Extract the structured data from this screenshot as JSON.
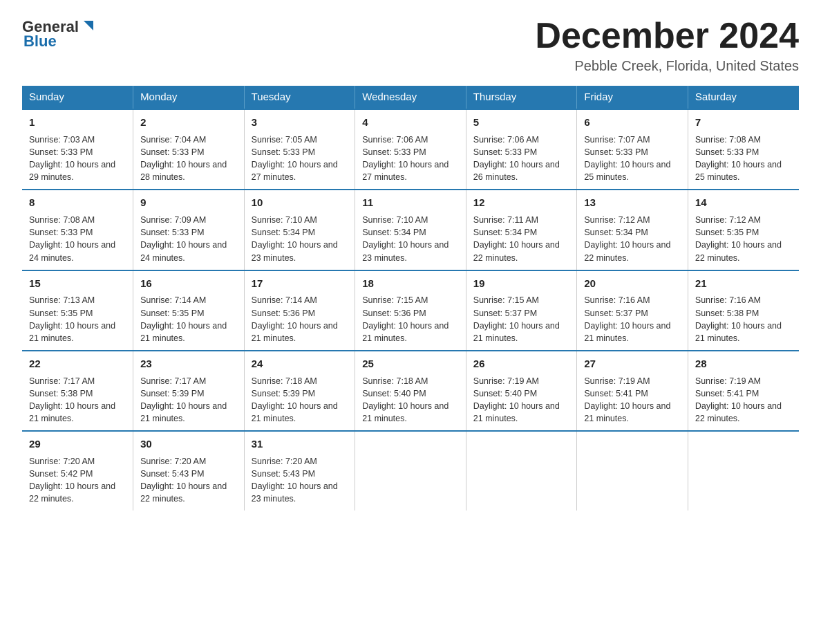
{
  "logo": {
    "general": "General",
    "blue": "Blue"
  },
  "title": "December 2024",
  "subtitle": "Pebble Creek, Florida, United States",
  "days_of_week": [
    "Sunday",
    "Monday",
    "Tuesday",
    "Wednesday",
    "Thursday",
    "Friday",
    "Saturday"
  ],
  "weeks": [
    [
      {
        "day": "1",
        "sunrise": "7:03 AM",
        "sunset": "5:33 PM",
        "daylight": "10 hours and 29 minutes."
      },
      {
        "day": "2",
        "sunrise": "7:04 AM",
        "sunset": "5:33 PM",
        "daylight": "10 hours and 28 minutes."
      },
      {
        "day": "3",
        "sunrise": "7:05 AM",
        "sunset": "5:33 PM",
        "daylight": "10 hours and 27 minutes."
      },
      {
        "day": "4",
        "sunrise": "7:06 AM",
        "sunset": "5:33 PM",
        "daylight": "10 hours and 27 minutes."
      },
      {
        "day": "5",
        "sunrise": "7:06 AM",
        "sunset": "5:33 PM",
        "daylight": "10 hours and 26 minutes."
      },
      {
        "day": "6",
        "sunrise": "7:07 AM",
        "sunset": "5:33 PM",
        "daylight": "10 hours and 25 minutes."
      },
      {
        "day": "7",
        "sunrise": "7:08 AM",
        "sunset": "5:33 PM",
        "daylight": "10 hours and 25 minutes."
      }
    ],
    [
      {
        "day": "8",
        "sunrise": "7:08 AM",
        "sunset": "5:33 PM",
        "daylight": "10 hours and 24 minutes."
      },
      {
        "day": "9",
        "sunrise": "7:09 AM",
        "sunset": "5:33 PM",
        "daylight": "10 hours and 24 minutes."
      },
      {
        "day": "10",
        "sunrise": "7:10 AM",
        "sunset": "5:34 PM",
        "daylight": "10 hours and 23 minutes."
      },
      {
        "day": "11",
        "sunrise": "7:10 AM",
        "sunset": "5:34 PM",
        "daylight": "10 hours and 23 minutes."
      },
      {
        "day": "12",
        "sunrise": "7:11 AM",
        "sunset": "5:34 PM",
        "daylight": "10 hours and 22 minutes."
      },
      {
        "day": "13",
        "sunrise": "7:12 AM",
        "sunset": "5:34 PM",
        "daylight": "10 hours and 22 minutes."
      },
      {
        "day": "14",
        "sunrise": "7:12 AM",
        "sunset": "5:35 PM",
        "daylight": "10 hours and 22 minutes."
      }
    ],
    [
      {
        "day": "15",
        "sunrise": "7:13 AM",
        "sunset": "5:35 PM",
        "daylight": "10 hours and 21 minutes."
      },
      {
        "day": "16",
        "sunrise": "7:14 AM",
        "sunset": "5:35 PM",
        "daylight": "10 hours and 21 minutes."
      },
      {
        "day": "17",
        "sunrise": "7:14 AM",
        "sunset": "5:36 PM",
        "daylight": "10 hours and 21 minutes."
      },
      {
        "day": "18",
        "sunrise": "7:15 AM",
        "sunset": "5:36 PM",
        "daylight": "10 hours and 21 minutes."
      },
      {
        "day": "19",
        "sunrise": "7:15 AM",
        "sunset": "5:37 PM",
        "daylight": "10 hours and 21 minutes."
      },
      {
        "day": "20",
        "sunrise": "7:16 AM",
        "sunset": "5:37 PM",
        "daylight": "10 hours and 21 minutes."
      },
      {
        "day": "21",
        "sunrise": "7:16 AM",
        "sunset": "5:38 PM",
        "daylight": "10 hours and 21 minutes."
      }
    ],
    [
      {
        "day": "22",
        "sunrise": "7:17 AM",
        "sunset": "5:38 PM",
        "daylight": "10 hours and 21 minutes."
      },
      {
        "day": "23",
        "sunrise": "7:17 AM",
        "sunset": "5:39 PM",
        "daylight": "10 hours and 21 minutes."
      },
      {
        "day": "24",
        "sunrise": "7:18 AM",
        "sunset": "5:39 PM",
        "daylight": "10 hours and 21 minutes."
      },
      {
        "day": "25",
        "sunrise": "7:18 AM",
        "sunset": "5:40 PM",
        "daylight": "10 hours and 21 minutes."
      },
      {
        "day": "26",
        "sunrise": "7:19 AM",
        "sunset": "5:40 PM",
        "daylight": "10 hours and 21 minutes."
      },
      {
        "day": "27",
        "sunrise": "7:19 AM",
        "sunset": "5:41 PM",
        "daylight": "10 hours and 21 minutes."
      },
      {
        "day": "28",
        "sunrise": "7:19 AM",
        "sunset": "5:41 PM",
        "daylight": "10 hours and 22 minutes."
      }
    ],
    [
      {
        "day": "29",
        "sunrise": "7:20 AM",
        "sunset": "5:42 PM",
        "daylight": "10 hours and 22 minutes."
      },
      {
        "day": "30",
        "sunrise": "7:20 AM",
        "sunset": "5:43 PM",
        "daylight": "10 hours and 22 minutes."
      },
      {
        "day": "31",
        "sunrise": "7:20 AM",
        "sunset": "5:43 PM",
        "daylight": "10 hours and 23 minutes."
      },
      {
        "day": "",
        "sunrise": "",
        "sunset": "",
        "daylight": ""
      },
      {
        "day": "",
        "sunrise": "",
        "sunset": "",
        "daylight": ""
      },
      {
        "day": "",
        "sunrise": "",
        "sunset": "",
        "daylight": ""
      },
      {
        "day": "",
        "sunrise": "",
        "sunset": "",
        "daylight": ""
      }
    ]
  ],
  "labels": {
    "sunrise_prefix": "Sunrise: ",
    "sunset_prefix": "Sunset: ",
    "daylight_prefix": "Daylight: "
  }
}
